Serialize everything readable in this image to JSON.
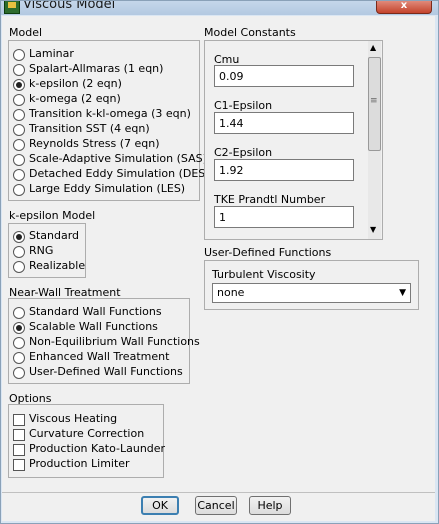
{
  "window": {
    "title": "Viscous Model",
    "close_label": "x"
  },
  "model": {
    "label": "Model",
    "options": [
      {
        "label": "Laminar",
        "selected": false
      },
      {
        "label": "Spalart-Allmaras (1 eqn)",
        "selected": false
      },
      {
        "label": "k-epsilon (2 eqn)",
        "selected": true
      },
      {
        "label": "k-omega (2 eqn)",
        "selected": false
      },
      {
        "label": "Transition k-kl-omega (3 eqn)",
        "selected": false
      },
      {
        "label": "Transition SST (4 eqn)",
        "selected": false
      },
      {
        "label": "Reynolds Stress (7 eqn)",
        "selected": false
      },
      {
        "label": "Scale-Adaptive Simulation (SAS)",
        "selected": false
      },
      {
        "label": "Detached Eddy Simulation (DES)",
        "selected": false
      },
      {
        "label": "Large Eddy Simulation (LES)",
        "selected": false
      }
    ]
  },
  "ke_model": {
    "label": "k-epsilon Model",
    "options": [
      {
        "label": "Standard",
        "selected": true
      },
      {
        "label": "RNG",
        "selected": false
      },
      {
        "label": "Realizable",
        "selected": false
      }
    ]
  },
  "near_wall": {
    "label": "Near-Wall Treatment",
    "options": [
      {
        "label": "Standard Wall Functions",
        "selected": false
      },
      {
        "label": "Scalable Wall Functions",
        "selected": true
      },
      {
        "label": "Non-Equilibrium Wall Functions",
        "selected": false
      },
      {
        "label": "Enhanced Wall Treatment",
        "selected": false
      },
      {
        "label": "User-Defined Wall Functions",
        "selected": false
      }
    ]
  },
  "options": {
    "label": "Options",
    "checks": [
      {
        "label": "Viscous Heating",
        "checked": false
      },
      {
        "label": "Curvature Correction",
        "checked": false
      },
      {
        "label": "Production Kato-Launder",
        "checked": false
      },
      {
        "label": "Production Limiter",
        "checked": false
      }
    ]
  },
  "constants": {
    "label": "Model Constants",
    "fields": [
      {
        "label": "Cmu",
        "value": "0.09"
      },
      {
        "label": "C1-Epsilon",
        "value": "1.44"
      },
      {
        "label": "C2-Epsilon",
        "value": "1.92"
      },
      {
        "label": "TKE Prandtl Number",
        "value": "1"
      }
    ]
  },
  "udf": {
    "label": "User-Defined Functions",
    "turb_label": "Turbulent Viscosity",
    "turb_value": "none"
  },
  "buttons": {
    "ok": "OK",
    "cancel": "Cancel",
    "help": "Help"
  }
}
